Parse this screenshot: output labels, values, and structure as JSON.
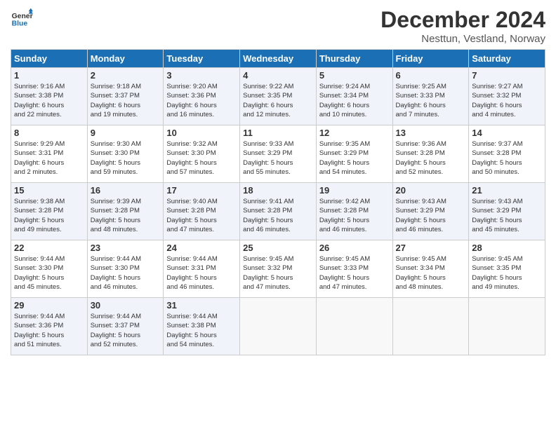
{
  "logo": {
    "line1": "General",
    "line2": "Blue"
  },
  "title": "December 2024",
  "subtitle": "Nesttun, Vestland, Norway",
  "header_days": [
    "Sunday",
    "Monday",
    "Tuesday",
    "Wednesday",
    "Thursday",
    "Friday",
    "Saturday"
  ],
  "weeks": [
    [
      {
        "day": "1",
        "info": "Sunrise: 9:16 AM\nSunset: 3:38 PM\nDaylight: 6 hours\nand 22 minutes."
      },
      {
        "day": "2",
        "info": "Sunrise: 9:18 AM\nSunset: 3:37 PM\nDaylight: 6 hours\nand 19 minutes."
      },
      {
        "day": "3",
        "info": "Sunrise: 9:20 AM\nSunset: 3:36 PM\nDaylight: 6 hours\nand 16 minutes."
      },
      {
        "day": "4",
        "info": "Sunrise: 9:22 AM\nSunset: 3:35 PM\nDaylight: 6 hours\nand 12 minutes."
      },
      {
        "day": "5",
        "info": "Sunrise: 9:24 AM\nSunset: 3:34 PM\nDaylight: 6 hours\nand 10 minutes."
      },
      {
        "day": "6",
        "info": "Sunrise: 9:25 AM\nSunset: 3:33 PM\nDaylight: 6 hours\nand 7 minutes."
      },
      {
        "day": "7",
        "info": "Sunrise: 9:27 AM\nSunset: 3:32 PM\nDaylight: 6 hours\nand 4 minutes."
      }
    ],
    [
      {
        "day": "8",
        "info": "Sunrise: 9:29 AM\nSunset: 3:31 PM\nDaylight: 6 hours\nand 2 minutes."
      },
      {
        "day": "9",
        "info": "Sunrise: 9:30 AM\nSunset: 3:30 PM\nDaylight: 5 hours\nand 59 minutes."
      },
      {
        "day": "10",
        "info": "Sunrise: 9:32 AM\nSunset: 3:30 PM\nDaylight: 5 hours\nand 57 minutes."
      },
      {
        "day": "11",
        "info": "Sunrise: 9:33 AM\nSunset: 3:29 PM\nDaylight: 5 hours\nand 55 minutes."
      },
      {
        "day": "12",
        "info": "Sunrise: 9:35 AM\nSunset: 3:29 PM\nDaylight: 5 hours\nand 54 minutes."
      },
      {
        "day": "13",
        "info": "Sunrise: 9:36 AM\nSunset: 3:28 PM\nDaylight: 5 hours\nand 52 minutes."
      },
      {
        "day": "14",
        "info": "Sunrise: 9:37 AM\nSunset: 3:28 PM\nDaylight: 5 hours\nand 50 minutes."
      }
    ],
    [
      {
        "day": "15",
        "info": "Sunrise: 9:38 AM\nSunset: 3:28 PM\nDaylight: 5 hours\nand 49 minutes."
      },
      {
        "day": "16",
        "info": "Sunrise: 9:39 AM\nSunset: 3:28 PM\nDaylight: 5 hours\nand 48 minutes."
      },
      {
        "day": "17",
        "info": "Sunrise: 9:40 AM\nSunset: 3:28 PM\nDaylight: 5 hours\nand 47 minutes."
      },
      {
        "day": "18",
        "info": "Sunrise: 9:41 AM\nSunset: 3:28 PM\nDaylight: 5 hours\nand 46 minutes."
      },
      {
        "day": "19",
        "info": "Sunrise: 9:42 AM\nSunset: 3:28 PM\nDaylight: 5 hours\nand 46 minutes."
      },
      {
        "day": "20",
        "info": "Sunrise: 9:43 AM\nSunset: 3:29 PM\nDaylight: 5 hours\nand 46 minutes."
      },
      {
        "day": "21",
        "info": "Sunrise: 9:43 AM\nSunset: 3:29 PM\nDaylight: 5 hours\nand 45 minutes."
      }
    ],
    [
      {
        "day": "22",
        "info": "Sunrise: 9:44 AM\nSunset: 3:30 PM\nDaylight: 5 hours\nand 45 minutes."
      },
      {
        "day": "23",
        "info": "Sunrise: 9:44 AM\nSunset: 3:30 PM\nDaylight: 5 hours\nand 46 minutes."
      },
      {
        "day": "24",
        "info": "Sunrise: 9:44 AM\nSunset: 3:31 PM\nDaylight: 5 hours\nand 46 minutes."
      },
      {
        "day": "25",
        "info": "Sunrise: 9:45 AM\nSunset: 3:32 PM\nDaylight: 5 hours\nand 47 minutes."
      },
      {
        "day": "26",
        "info": "Sunrise: 9:45 AM\nSunset: 3:33 PM\nDaylight: 5 hours\nand 47 minutes."
      },
      {
        "day": "27",
        "info": "Sunrise: 9:45 AM\nSunset: 3:34 PM\nDaylight: 5 hours\nand 48 minutes."
      },
      {
        "day": "28",
        "info": "Sunrise: 9:45 AM\nSunset: 3:35 PM\nDaylight: 5 hours\nand 49 minutes."
      }
    ],
    [
      {
        "day": "29",
        "info": "Sunrise: 9:44 AM\nSunset: 3:36 PM\nDaylight: 5 hours\nand 51 minutes."
      },
      {
        "day": "30",
        "info": "Sunrise: 9:44 AM\nSunset: 3:37 PM\nDaylight: 5 hours\nand 52 minutes."
      },
      {
        "day": "31",
        "info": "Sunrise: 9:44 AM\nSunset: 3:38 PM\nDaylight: 5 hours\nand 54 minutes."
      },
      null,
      null,
      null,
      null
    ]
  ]
}
